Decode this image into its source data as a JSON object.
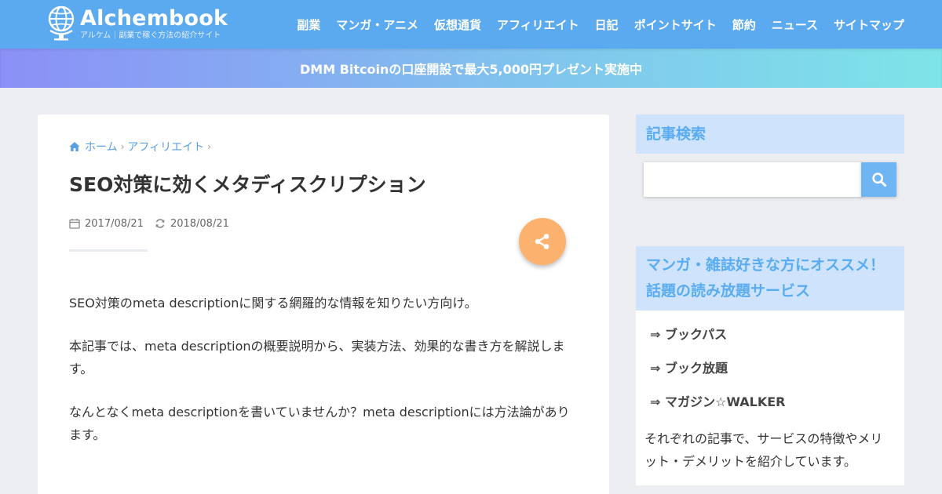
{
  "header": {
    "logo_title": "Alchembook",
    "logo_tagline": "アルケム｜副業で稼ぐ方法の紹介サイト",
    "nav": [
      "副業",
      "マンガ・アニメ",
      "仮想通貨",
      "アフィリエイト",
      "日記",
      "ポイントサイト",
      "節約",
      "ニュース",
      "サイトマップ"
    ]
  },
  "banner": {
    "text": "DMM Bitcoinの口座開設で最大5,000円プレゼント実施中"
  },
  "breadcrumb": {
    "home": "ホーム",
    "category": "アフィリエイト"
  },
  "article": {
    "title": "SEO対策に効くメタディスクリプション",
    "published": "2017/08/21",
    "updated": "2018/08/21",
    "paragraphs": [
      "SEO対策のmeta descriptionに関する網羅的な情報を知りたい方向け。",
      "本記事では、meta descriptionの概要説明から、実装方法、効果的な書き方を解説します。",
      "なんとなくmeta descriptionを書いていませんか？meta descriptionには方法論があります。"
    ]
  },
  "sidebar": {
    "search_heading": "記事検索",
    "search_placeholder": "",
    "widget_heading": "マンガ・雑誌好きな方にオススメ！話題の読み放題サービス",
    "links": [
      "⇒ ブックパス",
      "⇒ ブック放題",
      "⇒ マガジン☆WALKER"
    ],
    "description": "それぞれの記事で、サービスの特徴やメリット・デメリットを紹介しています。"
  },
  "colors": {
    "header_bg": "#5ba9ee",
    "share_button": "#fcb16f",
    "accent_link": "#5a9fe0",
    "sidebar_heading_bg": "#cfe4fc",
    "sidebar_heading_text": "#5aacf1"
  },
  "icons": [
    "globe-logo-icon",
    "home-icon",
    "calendar-icon",
    "refresh-icon",
    "share-icon",
    "search-icon"
  ]
}
